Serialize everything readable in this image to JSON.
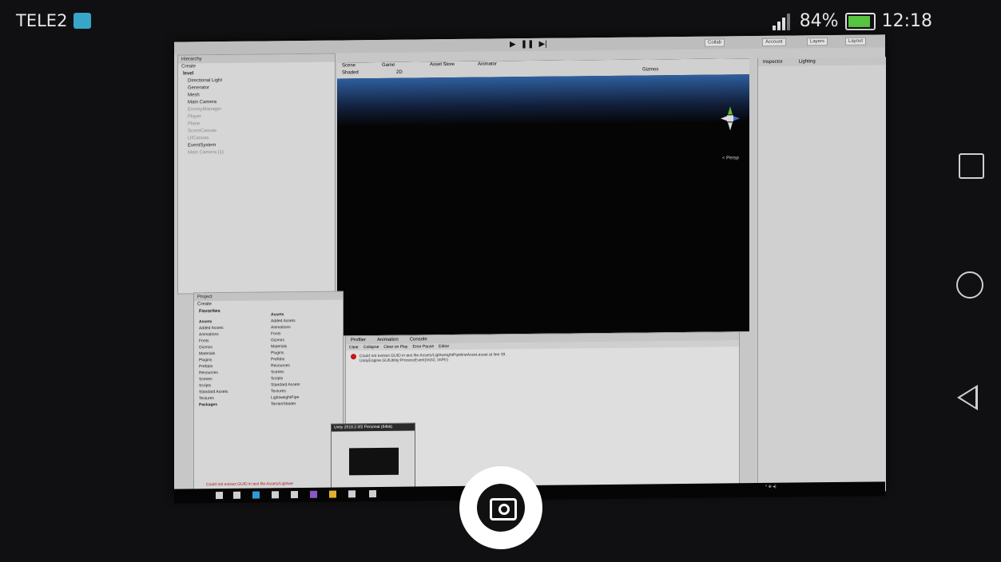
{
  "statusbar": {
    "carrier": "TELE2",
    "battery": "84%",
    "time": "12:18"
  },
  "unity": {
    "top_buttons": [
      "Collab",
      "Account",
      "Layers",
      "Layout"
    ],
    "scene_tabs": [
      "Scene",
      "Game",
      "Asset Store",
      "Animator"
    ],
    "scene_toolbar": {
      "shading": "Shaded",
      "mode": "2D",
      "gizmos": "Gizmos"
    },
    "persp_label": "< Persp",
    "hierarchy": {
      "tab": "Hierarchy",
      "create": "Create",
      "root": "level",
      "items": [
        "Directional Light",
        "Generator",
        "Mesh",
        "Main Camera",
        "EnemyManager",
        "Player",
        "Plane",
        "ScoreCanvas",
        "UICanvas",
        "EventSystem",
        "Main Camera (1)"
      ]
    },
    "project": {
      "tab": "Project",
      "create": "Create",
      "favorites": "Favorites",
      "assets_root": "Assets",
      "tree": [
        "Added Assets",
        "Animations",
        "Fonts",
        "Gizmos",
        "Materials",
        "Plugins",
        "Prefabs",
        "Resources",
        "Scenes",
        "Scripts",
        "Standard Assets",
        "Textures",
        "Packages"
      ],
      "assets_header": "Assets",
      "assets_list": [
        "Added Assets",
        "Animations",
        "Fonts",
        "Gizmos",
        "Materials",
        "Plugins",
        "Prefabs",
        "Resources",
        "Scenes",
        "Scripts",
        "Standard Assets",
        "Textures",
        "LightweightPipe",
        "TerrainShader"
      ]
    },
    "console": {
      "tabs": [
        "Profiler",
        "Animation",
        "Console"
      ],
      "toolbar": [
        "Clear",
        "Collapse",
        "Clear on Play",
        "Error Pause",
        "Editor"
      ],
      "error_line1": "Could not extract GUID in text file Assets/LightweightPipelineAsset.asset at line 39.",
      "error_line2": "UnityEngine.GUIUtility:ProcessEvent(Int32, IntPtr)"
    },
    "inspector": {
      "tabs": [
        "Inspector",
        "Lighting"
      ]
    },
    "taskbar_preview_title": "Unity 2018.2.0f2 Personal (64bit)",
    "status_error": "Could not extract GUID in text file Assets/Lightwe"
  }
}
